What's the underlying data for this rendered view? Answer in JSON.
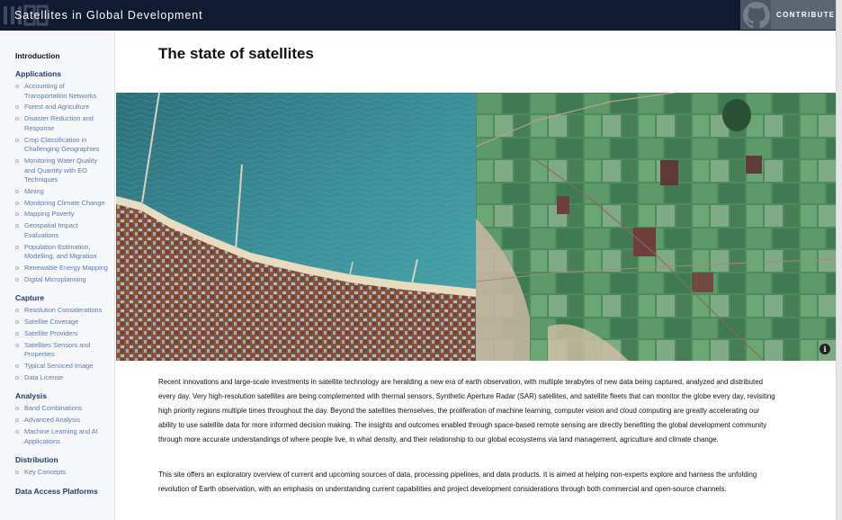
{
  "header": {
    "title": "Satellites in Global Development",
    "contribute_label": "CONTRIBUTE"
  },
  "sidebar": {
    "intro": "Introduction",
    "sections": [
      {
        "title": "Applications",
        "items": [
          "Accounting of Transportation Networks",
          "Forest and Agriculture",
          "Disaster Reduction and Response",
          "Crop Classification in Challenging Geographies",
          "Monitoring Water Quality and Quantity with EO Techniques",
          "Mining",
          "Monitoring Climate Change",
          "Mapping Poverty",
          "Geospatial Impact Evaluations",
          "Population Estimation, Modelling, and Migration",
          "Renewable Energy Mapping",
          "Digital Microplanning"
        ]
      },
      {
        "title": "Capture",
        "items": [
          "Resolution Considerations",
          "Satellite Coverage",
          "Satellite Providers",
          "Satellites Sensors and Properties",
          "Typical Serviced Image",
          "Data License"
        ]
      },
      {
        "title": "Analysis",
        "items": [
          "Band Combinations",
          "Advanced Analysis",
          "Machine Learning and AI Applications"
        ]
      },
      {
        "title": "Distribution",
        "items": [
          "Key Concepts"
        ]
      },
      {
        "title": "Data Access Platforms",
        "items": []
      }
    ]
  },
  "main": {
    "title": "The state of satellites",
    "info_glyph": "i",
    "paragraphs": [
      "Recent innovations and large-scale investments in satellite technology are heralding a new era of earth observation, with multiple terabytes of new data being captured, analyzed and distributed every day. Very high-resolution satellites are being complemented with thermal sensors, Synthetic Aperture Radar (SAR) satellites, and satellite fleets that can monitor the globe every day, revisiting high priority regions multiple times throughout the day. Beyond the satellites themselves, the proliferation of machine learning, computer vision and cloud computing are greatly accelerating our ability to use satellite data for more informed decision making. The insights and outcomes enabled through space-based remote sensing are directly benefiting the global development community through more accurate understandings of where people live, in what density, and their relationship to our global ecosystems via land management, agriculture and climate change.",
      "This site offers an exploratory overview of current and upcoming sources of data, processing pipelines, and data products. It is aimed at helping non-experts explore and harness the unfolding revolution of Earth observation, with an emphasis on understanding current capabilities and project development considerations through both commercial and open-source channels."
    ]
  },
  "colors": {
    "header_bg": "#0f1b30",
    "sidebar_bg": "#f6f7f9",
    "section_title": "#203c6c",
    "link": "#5a7bb1",
    "contribute_bg": "#5d6472"
  }
}
